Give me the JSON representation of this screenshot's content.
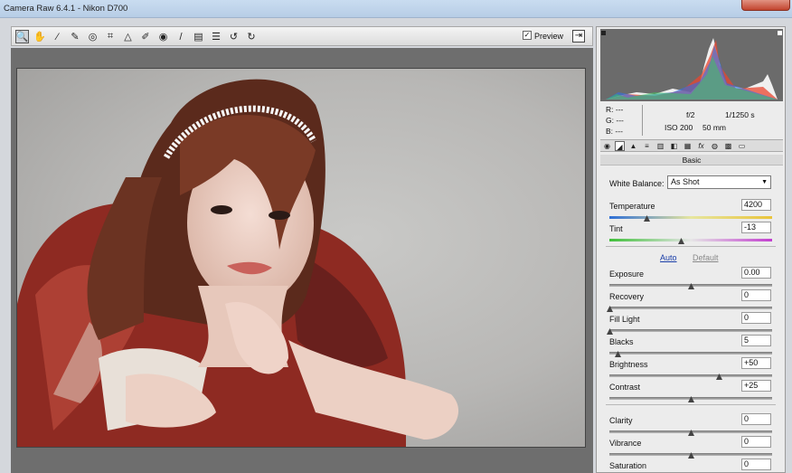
{
  "window": {
    "title": "Camera Raw 6.4.1  -  Nikon D700"
  },
  "toolbar": {
    "tools": [
      {
        "name": "zoom-tool-icon",
        "glyph": "🔍"
      },
      {
        "name": "hand-tool-icon",
        "glyph": "✋"
      },
      {
        "name": "white-balance-tool-icon",
        "glyph": "⁄"
      },
      {
        "name": "color-sampler-tool-icon",
        "glyph": "✎"
      },
      {
        "name": "targeted-adjustment-tool-icon",
        "glyph": "◎"
      },
      {
        "name": "crop-tool-icon",
        "glyph": "⌗"
      },
      {
        "name": "straighten-tool-icon",
        "glyph": "△"
      },
      {
        "name": "spot-removal-tool-icon",
        "glyph": "✐"
      },
      {
        "name": "red-eye-tool-icon",
        "glyph": "◉"
      },
      {
        "name": "adjustment-brush-icon",
        "glyph": "/"
      },
      {
        "name": "graduated-filter-icon",
        "glyph": "▤"
      },
      {
        "name": "preferences-icon",
        "glyph": "☰"
      },
      {
        "name": "rotate-ccw-icon",
        "glyph": "↺"
      },
      {
        "name": "rotate-cw-icon",
        "glyph": "↻"
      }
    ],
    "preview_checked": "✓",
    "preview_label": "Preview"
  },
  "readout": {
    "r_label": "R:",
    "r_val": "---",
    "g_label": "G:",
    "g_val": "---",
    "b_label": "B:",
    "b_val": "---",
    "aperture": "f/2",
    "shutter": "1/1250 s",
    "iso": "ISO 200",
    "focal": "50 mm"
  },
  "panel": {
    "section_title": "Basic",
    "white_balance_label": "White Balance:",
    "white_balance_value": "As Shot",
    "auto_label": "Auto",
    "default_label": "Default",
    "sliders": [
      {
        "label": "Temperature",
        "value": "4200",
        "level": 0.23,
        "track": "temp"
      },
      {
        "label": "Tint",
        "value": "-13",
        "level": 0.44,
        "track": "tint"
      },
      {
        "label": "Exposure",
        "value": "0.00",
        "level": 0.5,
        "track": "plain"
      },
      {
        "label": "Recovery",
        "value": "0",
        "level": 0.0,
        "track": "plain"
      },
      {
        "label": "Fill Light",
        "value": "0",
        "level": 0.0,
        "track": "plain"
      },
      {
        "label": "Blacks",
        "value": "5",
        "level": 0.05,
        "track": "plain"
      },
      {
        "label": "Brightness",
        "value": "+50",
        "level": 0.67,
        "track": "plain"
      },
      {
        "label": "Contrast",
        "value": "+25",
        "level": 0.5,
        "track": "plain"
      },
      {
        "label": "Clarity",
        "value": "0",
        "level": 0.5,
        "track": "plain"
      },
      {
        "label": "Vibrance",
        "value": "0",
        "level": 0.5,
        "track": "plain"
      },
      {
        "label": "Saturation",
        "value": "0",
        "level": 0.5,
        "track": "sat"
      }
    ]
  },
  "colors": {
    "accent_link": "#1a3ea8",
    "panel_bg": "#ececec",
    "photo_bg": "#6e6e6e"
  }
}
